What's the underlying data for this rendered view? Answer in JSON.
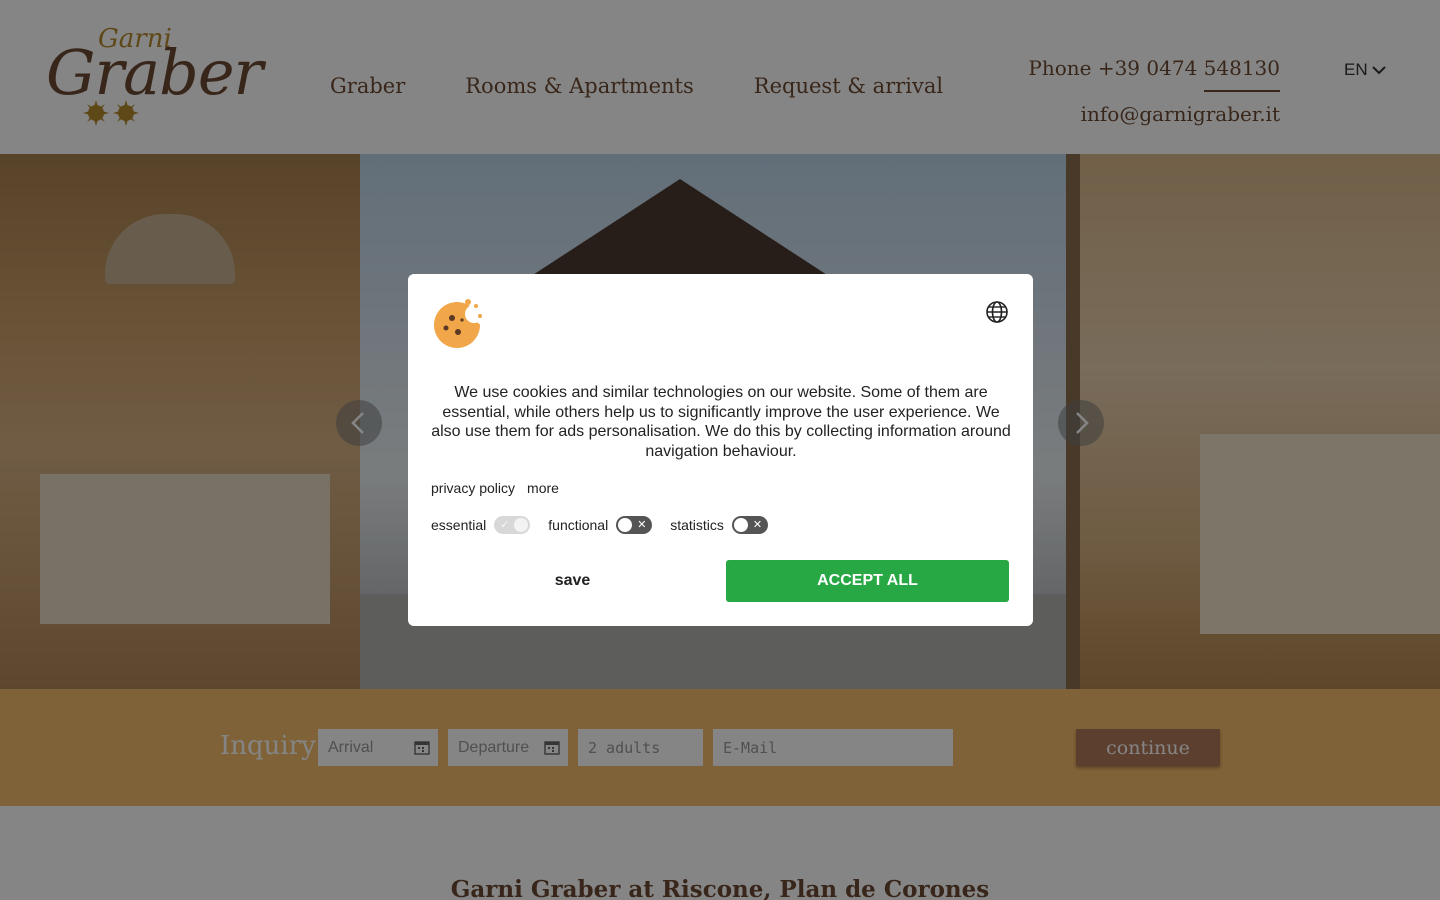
{
  "logo": {
    "line1": "Garni",
    "line2": "Graber"
  },
  "nav": {
    "items": [
      "Graber",
      "Rooms & Apartments",
      "Request & arrival"
    ]
  },
  "contact": {
    "phone": "Phone +39 0474 548130",
    "email": "info@garnigraber.it"
  },
  "language": {
    "current": "EN"
  },
  "inquiry": {
    "label": "Inquiry:",
    "arrival_placeholder": "Arrival",
    "departure_placeholder": "Departure",
    "adults_placeholder": "2 adults",
    "email_placeholder": "E-Mail",
    "continue_label": "continue"
  },
  "content": {
    "title": "Garni Graber at Riscone, Plan de Corones"
  },
  "cookie_banner": {
    "message": "We use cookies and similar technologies on our website. Some of them are essential, while others help us to significantly improve the user experience. We also use them for ads personalisation. We do this by collecting information around navigation behaviour.",
    "links": {
      "privacy": "privacy policy",
      "more": "more"
    },
    "toggles": [
      {
        "label": "essential",
        "state": "on-disabled"
      },
      {
        "label": "functional",
        "state": "off"
      },
      {
        "label": "statistics",
        "state": "off"
      }
    ],
    "save_label": "save",
    "accept_label": "ACCEPT ALL"
  },
  "colors": {
    "brand_brown": "#6d4a33",
    "brand_gold": "#b58a2c",
    "inquiry_bar": "#f4bd6c",
    "continue_button": "#b27a5a",
    "accept_button": "#27a844"
  },
  "icons": [
    "sun-star-icon",
    "chevron-down-icon",
    "arrow-left-icon",
    "arrow-right-icon",
    "calendar-icon",
    "cookie-icon",
    "globe-icon",
    "check-icon",
    "close-icon"
  ]
}
